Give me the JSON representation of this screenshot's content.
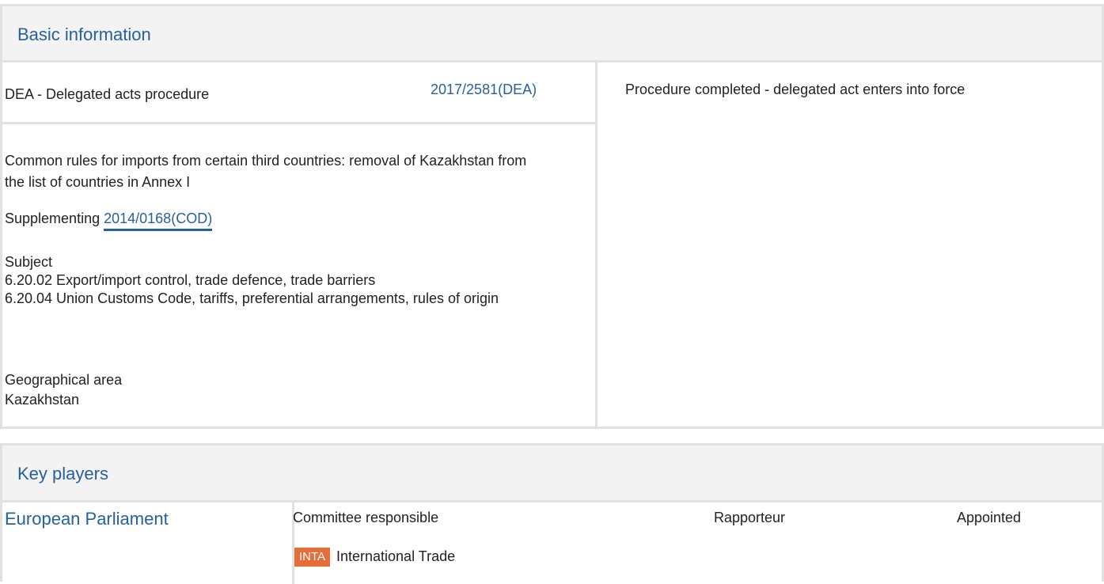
{
  "basic_info": {
    "title": "Basic information",
    "procedure_type": "DEA - Delegated acts procedure",
    "procedure_ref": "2017/2581(DEA)",
    "status": "Procedure completed - delegated act enters into force",
    "title_text": "Common rules for imports from certain third countries: removal of Kazakhstan from the list of countries in Annex I",
    "supplementing_label": "Supplementing",
    "supplementing_ref": "2014/0168(COD)",
    "subject_label": "Subject",
    "subjects": [
      "6.20.02 Export/import control, trade defence, trade barriers",
      "6.20.04 Union Customs Code, tariffs, preferential arrangements, rules of origin"
    ],
    "geo_label": "Geographical area",
    "geo_value": "Kazakhstan"
  },
  "key_players": {
    "title": "Key players",
    "institution": "European Parliament",
    "col_committee": "Committee responsible",
    "col_rapporteur": "Rapporteur",
    "col_appointed": "Appointed",
    "committee_code": "INTA",
    "committee_name": "International Trade",
    "badge_color": "#e46d38"
  }
}
